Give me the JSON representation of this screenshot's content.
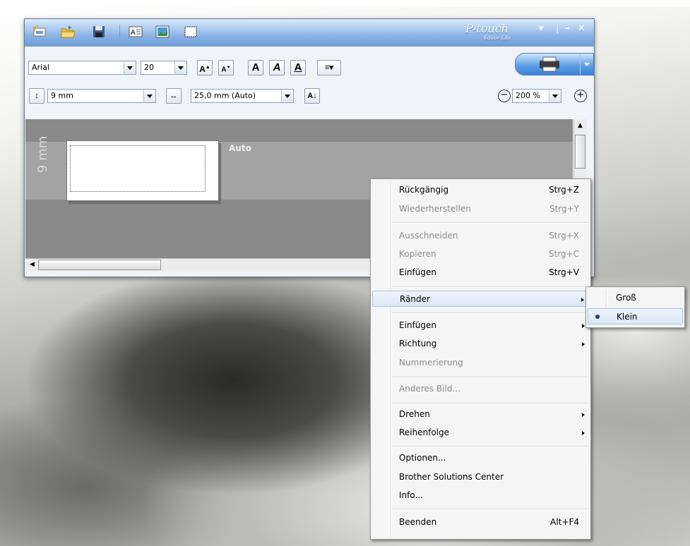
{
  "app": {
    "logo_text": "P-touch",
    "logo_sub": "Editor Lite"
  },
  "toolbar": {
    "font_name": "Arial",
    "font_size": "20",
    "tape_width": "9 mm",
    "label_length": "25,0 mm (Auto)",
    "zoom": "200 %"
  },
  "canvas": {
    "mm_label": "9 mm",
    "auto_label": "Auto"
  },
  "context_menu": {
    "items": [
      {
        "label": "Rückgängig",
        "shortcut": "Strg+Z",
        "enabled": true
      },
      {
        "label": "Wiederherstellen",
        "shortcut": "Strg+Y",
        "enabled": false
      },
      {
        "label": "Ausschneiden",
        "shortcut": "Strg+X",
        "enabled": false
      },
      {
        "label": "Kopieren",
        "shortcut": "Strg+C",
        "enabled": false
      },
      {
        "label": "Einfügen",
        "shortcut": "Strg+V",
        "enabled": true
      },
      {
        "label": "Ränder",
        "submenu": true,
        "enabled": true,
        "highlighted": true
      },
      {
        "label": "Einfügen",
        "submenu": true,
        "enabled": true
      },
      {
        "label": "Richtung",
        "submenu": true,
        "enabled": true
      },
      {
        "label": "Nummerierung",
        "enabled": false
      },
      {
        "label": "Anderes Bild...",
        "enabled": false
      },
      {
        "label": "Drehen",
        "submenu": true,
        "enabled": true
      },
      {
        "label": "Reihenfolge",
        "submenu": true,
        "enabled": true
      },
      {
        "label": "Optionen...",
        "enabled": true
      },
      {
        "label": "Brother Solutions Center",
        "enabled": true
      },
      {
        "label": "Info...",
        "enabled": true
      },
      {
        "label": "Beenden",
        "shortcut": "Alt+F4",
        "enabled": true
      }
    ]
  },
  "submenu_raender": {
    "items": [
      {
        "label": "Groß",
        "selected": false
      },
      {
        "label": "Klein",
        "selected": true
      }
    ]
  },
  "colors": {
    "titlebar": "#8db4e4",
    "menu_highlight": "#dbe8f6",
    "canvas": "#8a8a8a"
  }
}
